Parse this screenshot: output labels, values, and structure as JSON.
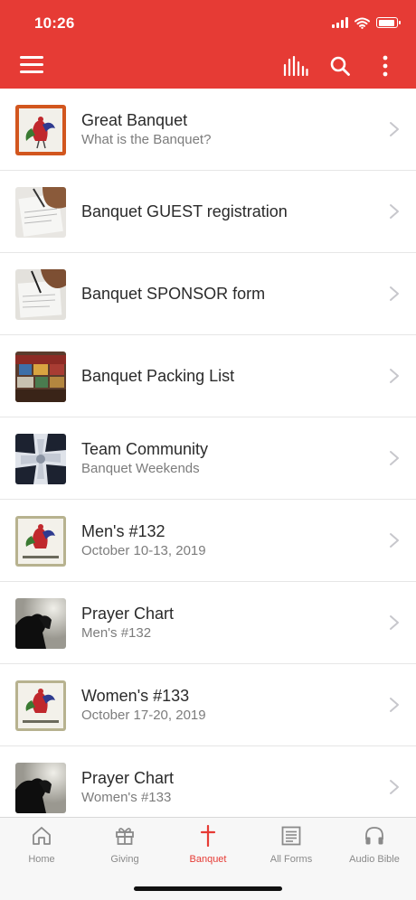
{
  "status": {
    "time": "10:26"
  },
  "topbar": {
    "menu_icon": "hamburger-icon",
    "actions": [
      "stats-icon",
      "search-icon",
      "more-vertical-icon"
    ],
    "color": "#e63b35"
  },
  "list": [
    {
      "title": "Great Banquet",
      "subtitle": "What is the Banquet?",
      "thumb": "rooster-orange"
    },
    {
      "title": "Banquet GUEST registration",
      "subtitle": "",
      "thumb": "writing-hand"
    },
    {
      "title": "Banquet SPONSOR form",
      "subtitle": "",
      "thumb": "writing-hand"
    },
    {
      "title": "Banquet Packing List",
      "subtitle": "",
      "thumb": "boxes"
    },
    {
      "title": "Team Community",
      "subtitle": "Banquet Weekends",
      "thumb": "cross-tiles"
    },
    {
      "title": "Men's #132",
      "subtitle": "October 10-13, 2019",
      "thumb": "rooster-beige",
      "thumb_caption": "Banquet Weekends"
    },
    {
      "title": "Prayer Chart",
      "subtitle": "Men's #132",
      "thumb": "prayer-silhouette"
    },
    {
      "title": "Women's #133",
      "subtitle": "October 17-20, 2019",
      "thumb": "rooster-beige",
      "thumb_caption": "Banquet Weekends"
    },
    {
      "title": "Prayer Chart",
      "subtitle": "Women's #133",
      "thumb": "prayer-silhouette"
    }
  ],
  "tabs": [
    {
      "label": "Home",
      "icon": "home-icon",
      "active": false
    },
    {
      "label": "Giving",
      "icon": "gift-icon",
      "active": false
    },
    {
      "label": "Banquet",
      "icon": "cross-icon",
      "active": true
    },
    {
      "label": "All Forms",
      "icon": "form-icon",
      "active": false
    },
    {
      "label": "Audio Bible",
      "icon": "headphones-icon",
      "active": false
    }
  ]
}
